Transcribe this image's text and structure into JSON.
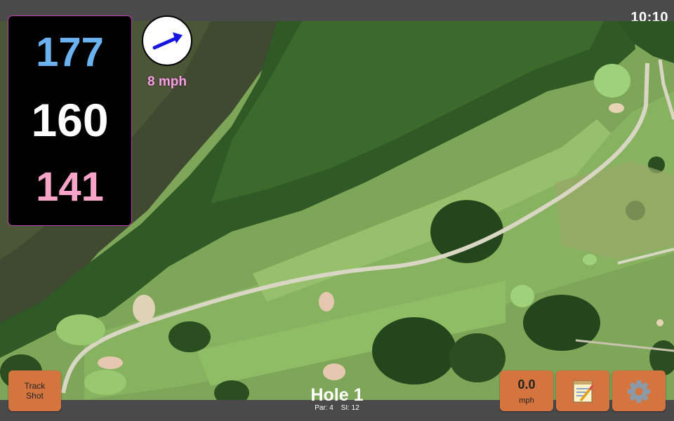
{
  "status": {
    "time": "10:10"
  },
  "distances": {
    "back": "177",
    "middle": "160",
    "front": "141"
  },
  "wind": {
    "speed": "8 mph",
    "direction_icon": "arrow-icon",
    "arrow_color": "#1515e0"
  },
  "hole": {
    "title": "Hole 1",
    "par": "Par: 4",
    "si": "SI: 12"
  },
  "buttons": {
    "track_shot": "Track\nShot",
    "speed_value": "0.0",
    "speed_unit": "mph",
    "notes_icon": "notepad-icon",
    "settings_icon": "gear-icon"
  },
  "colors": {
    "back_distance": "#6ab3f0",
    "middle_distance": "#ffffff",
    "front_distance": "#f7a4c8",
    "button": "#d47540",
    "panel_border": "#c23bb0"
  }
}
